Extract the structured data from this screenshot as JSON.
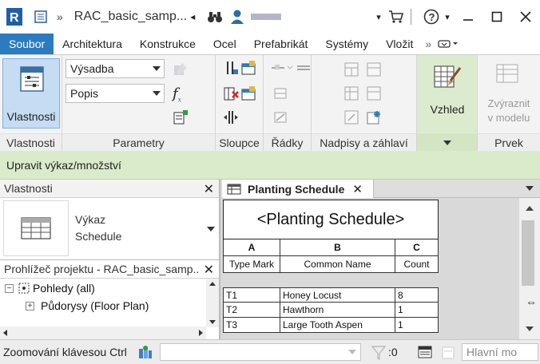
{
  "titlebar": {
    "app_letter": "R",
    "document_title": "RAC_basic_samp...",
    "title_arrow": "◂",
    "help_label": "?"
  },
  "tabs": [
    "Soubor",
    "Architektura",
    "Konstrukce",
    "Ocel",
    "Prefabrikát",
    "Systémy",
    "Vložit"
  ],
  "tabs_overflow": "»",
  "ribbon": {
    "properties_button": "Vlastnosti",
    "combo_phase": "Výsadba",
    "combo_filter": "Popis",
    "function_label": "f",
    "appearance_button": "Vzhled",
    "highlight_button_line1": "Zvýraznit",
    "highlight_button_line2": "v modelu",
    "panel_titles": {
      "properties": "Vlastnosti",
      "parameters": "Parametry",
      "columns": "Sloupce",
      "rows": "Řádky",
      "titles_headers": "Nadpisy a záhlaví",
      "element": "Prvek"
    }
  },
  "context_bar": "Upravit výkaz/množství",
  "properties_palette": {
    "title": "Vlastnosti",
    "type_line1": "Výkaz",
    "type_line2": "Schedule"
  },
  "project_browser": {
    "title": "Prohlížeč projektu - RAC_basic_samp...",
    "items": [
      {
        "label": "Pohledy (all)",
        "expander": "−"
      },
      {
        "label": "Půdorysy (Floor Plan)",
        "expander": "+"
      }
    ]
  },
  "view_tab": {
    "label": "Planting Schedule"
  },
  "schedule": {
    "title": "<Planting Schedule>",
    "column_letters": [
      "A",
      "B",
      "C"
    ],
    "column_headers": [
      "Type Mark",
      "Common Name",
      "Count"
    ],
    "rows": [
      [
        "T1",
        "Honey Locust",
        "8"
      ],
      [
        "T2",
        "Hawthorn",
        "1"
      ],
      [
        "T3",
        "Large Tooth Aspen",
        "1"
      ]
    ]
  },
  "statusbar": {
    "text": "Zoomování klávesou Ctrl",
    "selection_count": ":0",
    "model_combo": "Hlavní mo"
  },
  "colors": {
    "file_tab": "#2b7bc0",
    "context_bar": "#d9ebc9",
    "active_button": "#c5dcf2"
  }
}
